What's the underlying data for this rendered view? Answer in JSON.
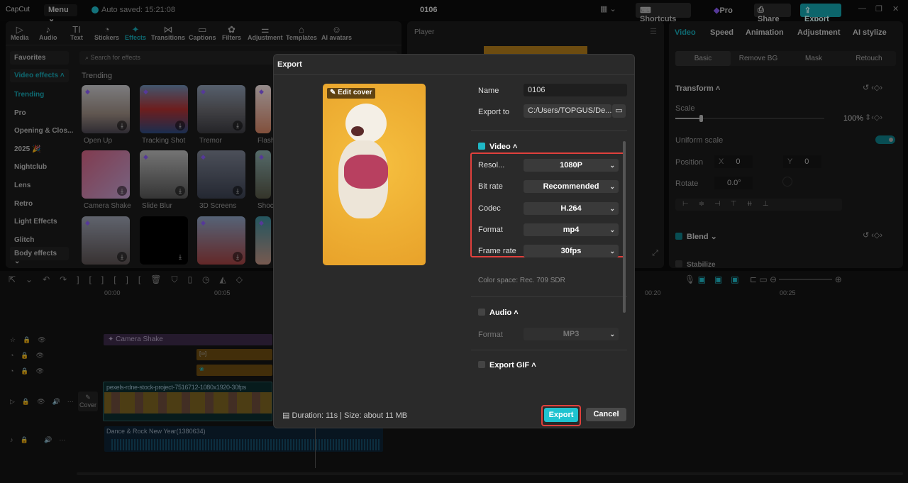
{
  "app": {
    "logo": "CapCut",
    "menu": "Menu",
    "autosave": "Auto saved: 15:21:08",
    "project_title": "0106",
    "shortcuts": "Shortcuts",
    "pro": "Pro",
    "share": "Share",
    "export": "Export"
  },
  "toolbar": [
    {
      "label": "Media",
      "icon": "▷"
    },
    {
      "label": "Audio",
      "icon": "♪"
    },
    {
      "label": "Text",
      "icon": "TI"
    },
    {
      "label": "Stickers",
      "icon": "◔"
    },
    {
      "label": "Effects",
      "icon": "✦"
    },
    {
      "label": "Transitions",
      "icon": "⋈"
    },
    {
      "label": "Captions",
      "icon": "▭"
    },
    {
      "label": "Filters",
      "icon": "✿"
    },
    {
      "label": "Adjustment",
      "icon": "⚌"
    },
    {
      "label": "Templates",
      "icon": "⌂"
    },
    {
      "label": "AI avatars",
      "icon": "☺"
    }
  ],
  "effects": {
    "favorites": "Favorites",
    "video_effects": "Video effects",
    "search_placeholder": "Search for effects",
    "section": "Trending",
    "categories": [
      "Trending",
      "Pro",
      "Opening & Clos...",
      "2025 🎉",
      "Nightclub",
      "Lens",
      "Retro",
      "Light Effects",
      "Glitch"
    ],
    "body_effects": "Body effects",
    "items": [
      "Open Up",
      "Tracking Shot",
      "Tremor",
      "Flash",
      "Camera Shake",
      "Slide Blur",
      "3D Screens",
      "Shock",
      "",
      "",
      "",
      ""
    ]
  },
  "player": {
    "title": "Player"
  },
  "right": {
    "tabs": [
      "Video",
      "Speed",
      "Animation",
      "Adjustment",
      "AI stylize"
    ],
    "subtabs": [
      "Basic",
      "Remove BG",
      "Mask",
      "Retouch"
    ],
    "transform": "Transform",
    "scale": "Scale",
    "scale_value": "100%",
    "scale_fraction": 0.17,
    "uniform_scale": "Uniform scale",
    "position": "Position",
    "x_label": "X",
    "x": "0",
    "y_label": "Y",
    "y": "0",
    "rotate": "Rotate",
    "rotate_value": "0.0°",
    "blend": "Blend",
    "stabilize": "Stabilize"
  },
  "timeline": {
    "ticks": [
      "00:00",
      "00:05",
      "00:20",
      "00:25"
    ],
    "cover": "Cover",
    "effect_clip": "Camera Shake",
    "video_clip": "pexels-rdne-stock-project-7516712-1080x1920-30fps",
    "audio_clip": "Dance & Rock New Year(1380634)"
  },
  "dialog": {
    "title": "Export",
    "edit_cover": "Edit cover",
    "name_label": "Name",
    "name": "0106",
    "export_to_label": "Export to",
    "export_to": "C:/Users/TOPGUS/De...",
    "video": "Video",
    "rows": [
      {
        "label": "Resol...",
        "value": "1080P"
      },
      {
        "label": "Bit rate",
        "value": "Recommended"
      },
      {
        "label": "Codec",
        "value": "H.264"
      },
      {
        "label": "Format",
        "value": "mp4"
      },
      {
        "label": "Frame rate",
        "value": "30fps"
      }
    ],
    "color_space": "Color space: Rec. 709 SDR",
    "audio": "Audio",
    "audio_format_label": "Format",
    "audio_format": "MP3",
    "gif": "Export GIF",
    "summary": "Duration: 11s | Size: about 11 MB",
    "export_btn": "Export",
    "cancel_btn": "Cancel"
  },
  "colors": {
    "accent": "#1fb8c6",
    "highlight": "#e0403c"
  }
}
